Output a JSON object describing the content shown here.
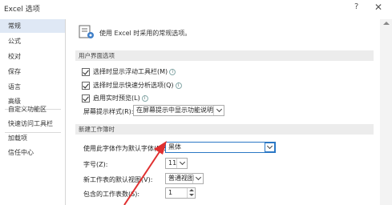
{
  "window": {
    "title": "Excel 选项",
    "help": "?",
    "close": "✕"
  },
  "sidebar": {
    "items": [
      {
        "label": "常规",
        "active": true
      },
      {
        "label": "公式"
      },
      {
        "label": "校对"
      },
      {
        "label": "保存"
      },
      {
        "label": "语言"
      },
      {
        "label": "高级"
      },
      {
        "label": "自定义功能区"
      },
      {
        "label": "快速访问工具栏"
      },
      {
        "label": "加载项"
      },
      {
        "label": "信任中心"
      }
    ]
  },
  "main": {
    "header": "使用 Excel 时采用的常规选项。",
    "ui_section": {
      "title": "用户界面选项",
      "options": [
        {
          "label": "选择时显示浮动工具栏(M)",
          "checked": true
        },
        {
          "label": "选择时显示快速分析选项(Q)",
          "checked": true
        },
        {
          "label": "启用实时预览(L)",
          "checked": true
        }
      ],
      "tooltip_style_label": "屏幕提示样式(R):",
      "tooltip_style_value": "在屏幕提示中显示功能说明"
    },
    "new_workbook": {
      "title": "新建工作簿时",
      "font_label": "使用此字体作为默认字体(N):",
      "font_value": "黑体",
      "size_label": "字号(Z):",
      "size_value": "11",
      "view_label": "新工作表的默认视图(V):",
      "view_value": "普通视图",
      "sheets_label": "包含的工作表数(S):",
      "sheets_value": "1"
    }
  },
  "colors": {
    "accent": "#2b78c5",
    "annotation": "#e03030",
    "active_nav": "#dfe8f5"
  }
}
